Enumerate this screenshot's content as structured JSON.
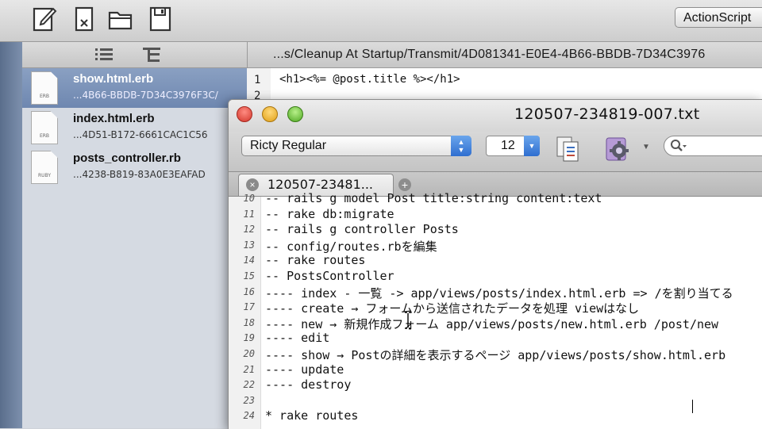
{
  "back_window": {
    "toolbar": {
      "language_button": "ActionScript",
      "icons": [
        "new-document-icon",
        "close-document-icon",
        "open-folder-icon",
        "save-icon"
      ]
    },
    "subbar": {
      "icons": [
        "list-view-icon",
        "outline-view-icon"
      ],
      "path": "...s/Cleanup At Startup/Transmit/4D081341-E0E4-4B66-BBDB-7D34C3976"
    },
    "files": [
      {
        "name": "show.html.erb",
        "id": "...4B66-BBDB-7D34C3976F3C/",
        "tag": "ERB",
        "selected": true
      },
      {
        "name": "index.html.erb",
        "id": "...4D51-B172-6661CAC1C56",
        "tag": "ERB",
        "selected": false
      },
      {
        "name": "posts_controller.rb",
        "id": "...4238-B819-83A0E3EAFAD",
        "tag": "RUBY",
        "selected": false
      }
    ],
    "editor": {
      "line_numbers": [
        "1",
        "2"
      ],
      "first_line": "<h1><%= @post.title %></h1>"
    }
  },
  "front_window": {
    "title": "120507-234819-007.txt",
    "font_name": "Ricty Regular",
    "font_size": "12",
    "tab_label": "120507-23481...",
    "tab_close_glyph": "×",
    "tab_add_glyph": "+",
    "lines": [
      {
        "n": "10",
        "text": "-- rails g model Post title:string content:text"
      },
      {
        "n": "11",
        "text": "-- rake db:migrate"
      },
      {
        "n": "12",
        "text": "-- rails g controller Posts"
      },
      {
        "n": "13",
        "text": "-- config/routes.rbを編集"
      },
      {
        "n": "14",
        "text": "-- rake routes"
      },
      {
        "n": "15",
        "text": "-- PostsController"
      },
      {
        "n": "16",
        "text": "---- index - 一覧 -> app/views/posts/index.html.erb => /を割り当てる"
      },
      {
        "n": "17",
        "text": "---- create → フォームから送信されたデータを処理 viewはなし"
      },
      {
        "n": "18",
        "text": "---- new → 新規作成フォーム app/views/posts/new.html.erb /post/new"
      },
      {
        "n": "19",
        "text": "---- edit"
      },
      {
        "n": "20",
        "text": "---- show → Postの詳細を表示するページ app/views/posts/show.html.erb"
      },
      {
        "n": "21",
        "text": "---- update"
      },
      {
        "n": "22",
        "text": "---- destroy"
      },
      {
        "n": "23",
        "text": ""
      },
      {
        "n": "24",
        "text": "* rake routes"
      }
    ]
  },
  "colors": {
    "selection": "#7a92b8",
    "close_button": "#e0463b",
    "minimize_button": "#f0b429",
    "zoom_button": "#62c12f",
    "popup_arrow": "#3b7de0"
  }
}
